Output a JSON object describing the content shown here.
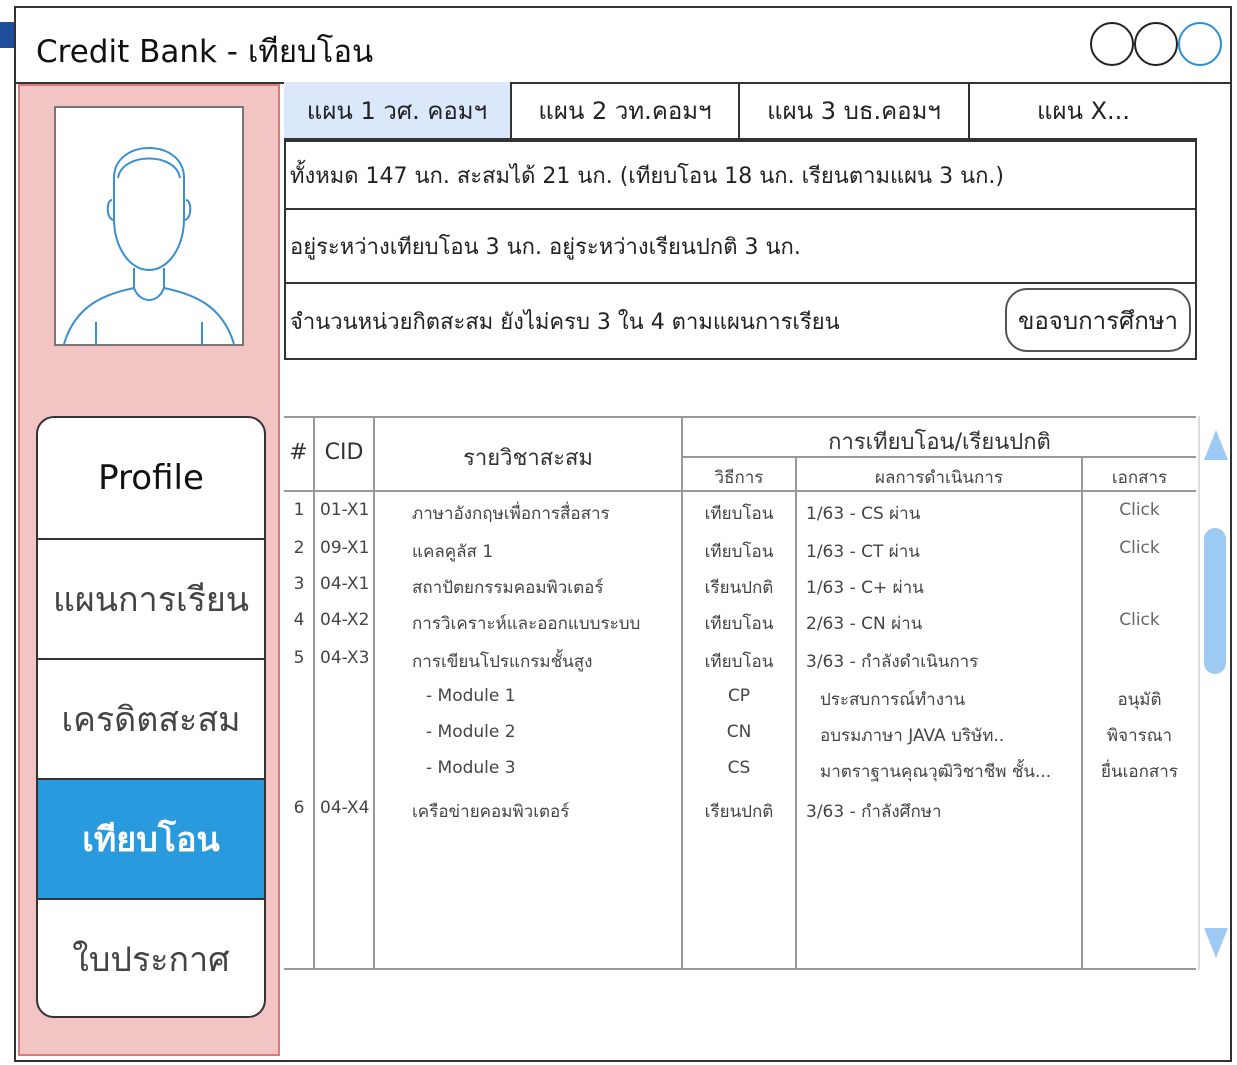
{
  "window": {
    "title": "Credit Bank - เทียบโอน"
  },
  "sidebar": {
    "avatar_icon": "user-avatar-outline-icon",
    "items": [
      {
        "label": "Profile"
      },
      {
        "label": "แผนการเรียน"
      },
      {
        "label": "เครดิตสะสม"
      },
      {
        "label": "เทียบโอน",
        "active": true
      },
      {
        "label": "ใบประกาศ"
      }
    ]
  },
  "tabs": [
    {
      "label": "แผน 1 วศ. คอมฯ",
      "active": true
    },
    {
      "label": "แผน 2 วท.คอมฯ"
    },
    {
      "label": "แผน 3 บธ.คอมฯ"
    },
    {
      "label": "แผน X..."
    }
  ],
  "summary": {
    "line1": "ทั้งหมด 147 นก. สะสมได้ 21 นก. (เทียบโอน 18 นก. เรียนตามแผน 3 นก.)",
    "line2": "อยู่ระหว่างเทียบโอน 3 นก. อยู่ระหว่างเรียนปกติ 3 นก.",
    "line3": "จำนวนหน่วยกิตสะสม ยังไม่ครบ 3 ใน 4 ตามแผนการเรียน",
    "graduate_button": "ขอจบการศึกษา"
  },
  "table": {
    "headers": {
      "no": "#",
      "cid": "CID",
      "subject": "รายวิชาสะสม",
      "group": "การเทียบโอน/เรียนปกติ",
      "method": "วิธีการ",
      "result": "ผลการดำเนินการ",
      "document": "เอกสาร"
    },
    "rows": [
      {
        "no": "1",
        "cid": "01-X1",
        "subject": "ภาษาอังกฤษเพื่อการสื่อสาร",
        "method": "เทียบโอน",
        "result": "1/63 - CS ผ่าน",
        "document": "Click"
      },
      {
        "no": "2",
        "cid": "09-X1",
        "subject": "แคลคูลัส 1",
        "method": "เทียบโอน",
        "result": "1/63 - CT ผ่าน",
        "document": "Click"
      },
      {
        "no": "3",
        "cid": "04-X1",
        "subject": "สถาปัตยกรรมคอมพิวเตอร์",
        "method": "เรียนปกติ",
        "result": "1/63 -  C+ ผ่าน",
        "document": ""
      },
      {
        "no": "4",
        "cid": "04-X2",
        "subject": "การวิเคราะห์และออกแบบระบบ",
        "method": "เทียบโอน",
        "result": "2/63 - CN ผ่าน",
        "document": "Click"
      },
      {
        "no": "5",
        "cid": "04-X3",
        "subject": "การเขียนโปรแกรมชั้นสูง",
        "method": "เทียบโอน",
        "result": "3/63 - กำลังดำเนินการ",
        "document": ""
      },
      {
        "no": "",
        "cid": "",
        "subject": "- Module 1",
        "method": "CP",
        "result": "ประสบการณ์ทำงาน",
        "document": "อนุมัติ"
      },
      {
        "no": "",
        "cid": "",
        "subject": "- Module 2",
        "method": "CN",
        "result": "อบรมภาษา JAVA บริษัท..",
        "document": "พิจารณา"
      },
      {
        "no": "",
        "cid": "",
        "subject": "- Module 3",
        "method": "CS",
        "result": "มาตราฐานคุณวุฒิวิชาชีพ ชั้น...",
        "document": "ยื่นเอกสาร"
      },
      {
        "no": "6",
        "cid": "04-X4",
        "subject": "เครือข่ายคอมพิวเตอร์",
        "method": "เรียนปกติ",
        "result": "3/63 - กำลังศึกษา",
        "document": ""
      }
    ]
  },
  "scrollbar": {
    "up_icon": "arrow-up-icon",
    "down_icon": "arrow-down-icon"
  }
}
